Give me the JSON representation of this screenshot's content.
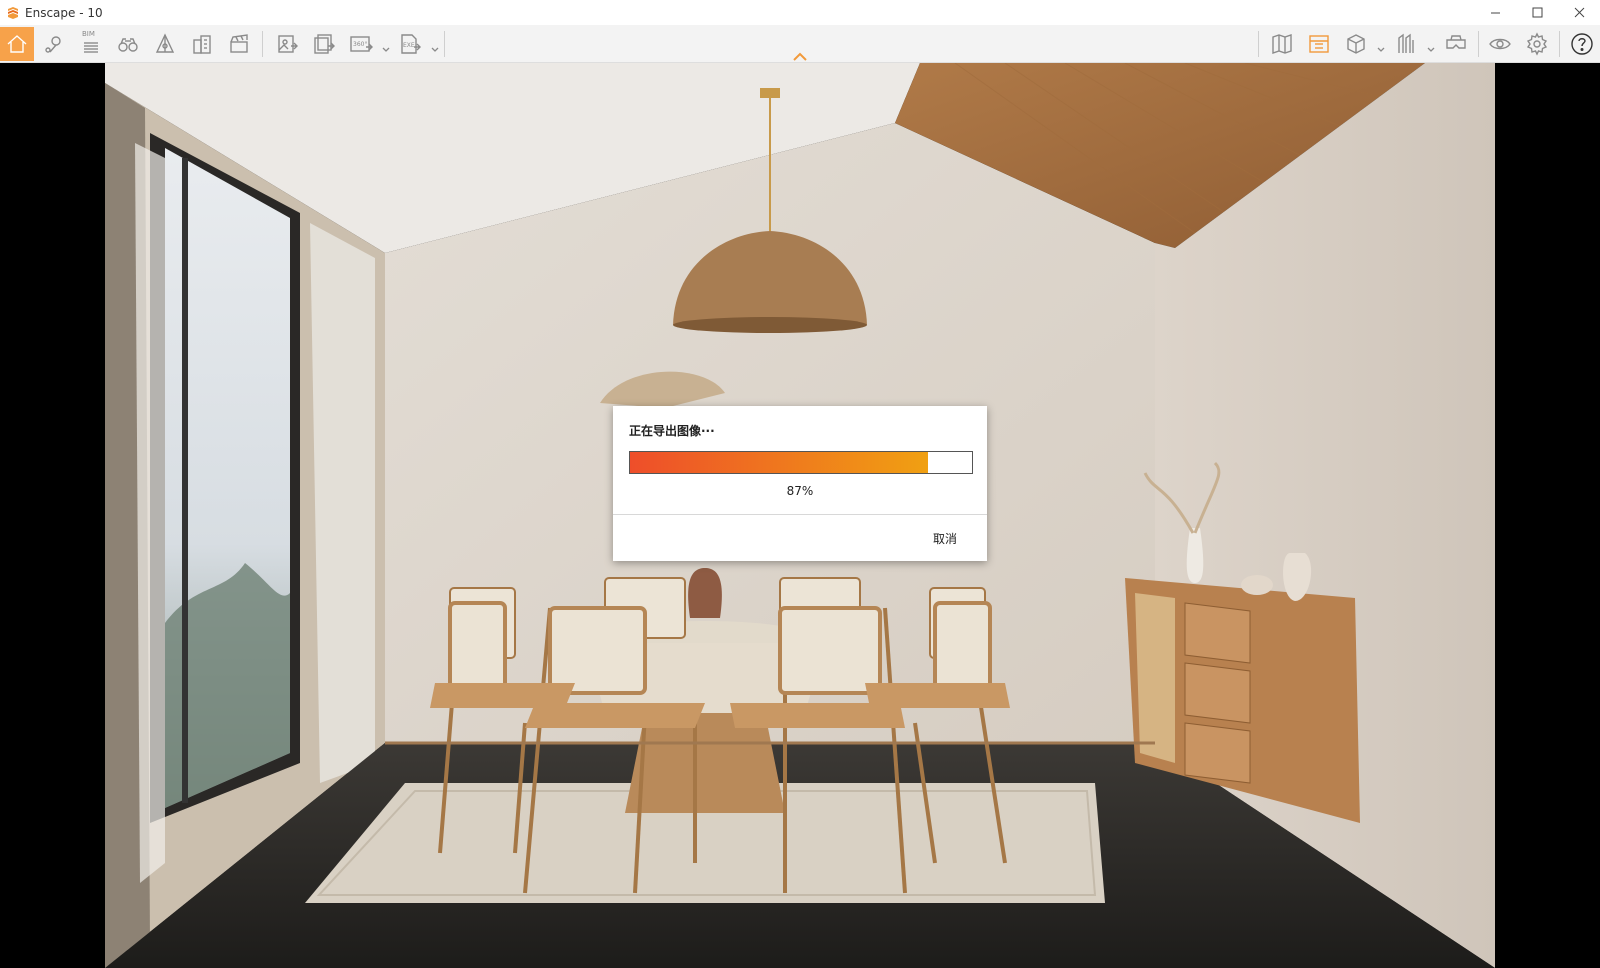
{
  "window": {
    "title": "Enscape - 10",
    "icon": "enscape-logo-icon"
  },
  "toolbar": {
    "bim_label": "BIM",
    "left_buttons": [
      "home-icon",
      "location-pin-icon",
      "bim-info-icon",
      "binoculars-icon",
      "perspective-icon",
      "buildings-icon",
      "clapperboard-icon",
      "render-export-icon",
      "batch-render-icon",
      "panorama-360-icon",
      "exe-export-icon"
    ],
    "right_buttons": [
      "map-icon",
      "asset-library-icon",
      "cube-icon",
      "site-context-icon",
      "vr-headset-icon",
      "visibility-eye-icon",
      "settings-gear-icon",
      "help-icon"
    ],
    "panorama_label": "360°",
    "exe_label": "EXE"
  },
  "dialog": {
    "title": "正在导出图像···",
    "progress": 0.87,
    "progress_text": "87%",
    "cancel_label": "取消"
  },
  "colors": {
    "accent": "#f29a3b",
    "progress_start": "#ee4e2a",
    "progress_end": "#f0a012"
  }
}
